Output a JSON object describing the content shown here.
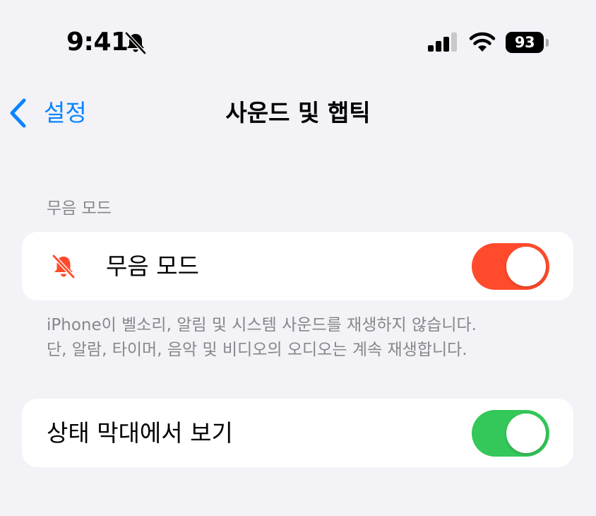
{
  "status_bar": {
    "time": "9:41",
    "mute_icon": "bell-slash-icon",
    "signal_icon": "cellular-signal-icon",
    "wifi_icon": "wifi-icon",
    "battery_level": "93"
  },
  "nav": {
    "back_icon": "chevron-left-icon",
    "back_label": "설정",
    "title": "사운드 및 햅틱"
  },
  "section_silent": {
    "header": "무음 모드",
    "row": {
      "icon": "bell-slash-icon",
      "label": "무음 모드",
      "toggle_on": true
    },
    "footer_lines": [
      "iPhone이 벨소리, 알림 및 시스템 사운드를 재생하지 않습니다.",
      "단, 알람, 타이머, 음악 및 비디오의 오디오는 계속 재생합니다."
    ]
  },
  "section_status": {
    "row": {
      "label": "상태 막대에서 보기",
      "toggle_on": true
    }
  },
  "colors": {
    "background": "#f2f2f7",
    "card": "#ffffff",
    "accent_blue": "#0a84ff",
    "silent_red": "#ff4b2b",
    "toggle_green": "#34c759",
    "secondary_text": "#86868b"
  }
}
